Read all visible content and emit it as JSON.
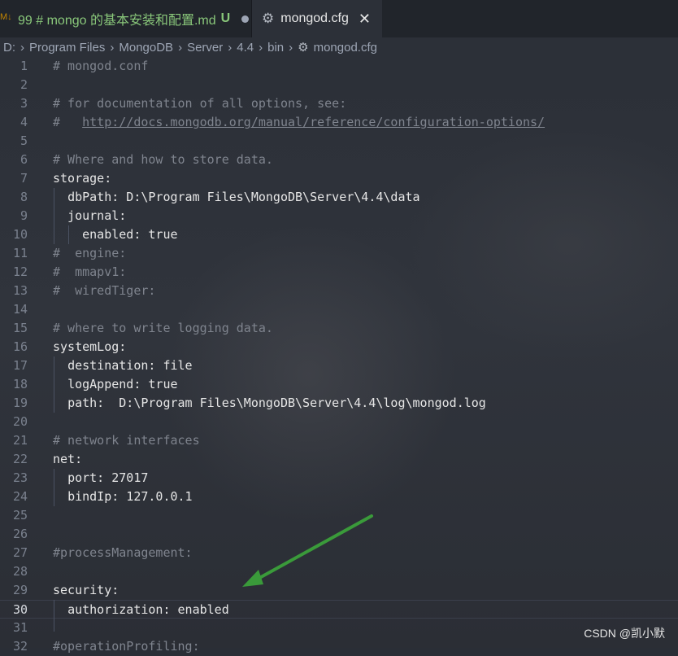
{
  "tabs": [
    {
      "label": "99 # mongo 的基本安装和配置.md",
      "icon": "markdown-icon",
      "badge": "U",
      "modified": true
    },
    {
      "label": "mongod.cfg",
      "icon": "gear-icon",
      "close": "✕"
    }
  ],
  "breadcrumb": [
    "D:",
    "Program Files",
    "MongoDB",
    "Server",
    "4.4",
    "bin",
    "mongod.cfg"
  ],
  "lines": [
    {
      "n": "1",
      "text": "# mongod.conf"
    },
    {
      "n": "2",
      "text": ""
    },
    {
      "n": "3",
      "text": "# for documentation of all options, see:"
    },
    {
      "n": "4",
      "text": "#   http://docs.mongodb.org/manual/reference/configuration-options/"
    },
    {
      "n": "5",
      "text": ""
    },
    {
      "n": "6",
      "text": "# Where and how to store data."
    },
    {
      "n": "7",
      "text": "storage:"
    },
    {
      "n": "8",
      "text": "  dbPath: D:\\Program Files\\MongoDB\\Server\\4.4\\data"
    },
    {
      "n": "9",
      "text": "  journal:"
    },
    {
      "n": "10",
      "text": "    enabled: true"
    },
    {
      "n": "11",
      "text": "#  engine:"
    },
    {
      "n": "12",
      "text": "#  mmapv1:"
    },
    {
      "n": "13",
      "text": "#  wiredTiger:"
    },
    {
      "n": "14",
      "text": ""
    },
    {
      "n": "15",
      "text": "# where to write logging data."
    },
    {
      "n": "16",
      "text": "systemLog:"
    },
    {
      "n": "17",
      "text": "  destination: file"
    },
    {
      "n": "18",
      "text": "  logAppend: true"
    },
    {
      "n": "19",
      "text": "  path:  D:\\Program Files\\MongoDB\\Server\\4.4\\log\\mongod.log"
    },
    {
      "n": "20",
      "text": ""
    },
    {
      "n": "21",
      "text": "# network interfaces"
    },
    {
      "n": "22",
      "text": "net:"
    },
    {
      "n": "23",
      "text": "  port: 27017"
    },
    {
      "n": "24",
      "text": "  bindIp: 127.0.0.1"
    },
    {
      "n": "25",
      "text": ""
    },
    {
      "n": "26",
      "text": ""
    },
    {
      "n": "27",
      "text": "#processManagement:"
    },
    {
      "n": "28",
      "text": ""
    },
    {
      "n": "29",
      "text": "security:"
    },
    {
      "n": "30",
      "text": "  authorization: enabled"
    },
    {
      "n": "31",
      "text": ""
    },
    {
      "n": "32",
      "text": "#operationProfiling:"
    }
  ],
  "current_line": "30",
  "watermark": "CSDN @凯小默",
  "colors": {
    "arrow": "#3a9a3a",
    "tab_modified": "#89c77a",
    "comment": "#7f848e"
  }
}
